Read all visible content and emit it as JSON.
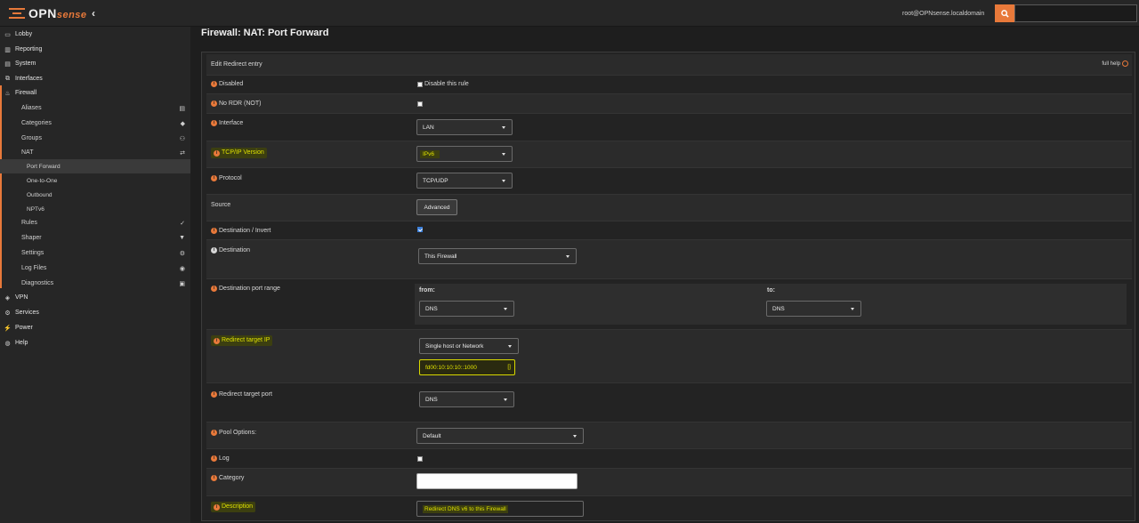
{
  "topbar": {
    "logo_main": "OPN",
    "logo_sense": "sense",
    "collapse_glyph": "‹",
    "user": "root@OPNsense.localdomain",
    "search_icon": "search-icon",
    "search_value": ""
  },
  "sidebar": {
    "items": [
      {
        "label": "Lobby",
        "icon": "▭"
      },
      {
        "label": "Reporting",
        "icon": "▥"
      },
      {
        "label": "System",
        "icon": "▤"
      },
      {
        "label": "Interfaces",
        "icon": "⧉"
      },
      {
        "label": "Firewall",
        "icon": "♨"
      },
      {
        "label": "Aliases",
        "right": "▤"
      },
      {
        "label": "Categories",
        "right": "◆"
      },
      {
        "label": "Groups",
        "right": "⚇"
      },
      {
        "label": "NAT",
        "right": "⇄"
      },
      {
        "label": "Port Forward"
      },
      {
        "label": "One-to-One"
      },
      {
        "label": "Outbound"
      },
      {
        "label": "NPTv6"
      },
      {
        "label": "Rules",
        "right": "✓"
      },
      {
        "label": "Shaper",
        "right": "▼"
      },
      {
        "label": "Settings",
        "right": "⚙"
      },
      {
        "label": "Log Files",
        "right": "◉"
      },
      {
        "label": "Diagnostics",
        "right": "▣"
      },
      {
        "label": "VPN",
        "icon": "◈"
      },
      {
        "label": "Services",
        "icon": "⚙"
      },
      {
        "label": "Power",
        "icon": "⚡"
      },
      {
        "label": "Help",
        "icon": "◍"
      }
    ]
  },
  "page": {
    "title": "Firewall: NAT: Port Forward",
    "panel_title": "Edit Redirect entry",
    "full_help": "full help"
  },
  "form": {
    "disabled": {
      "label": "Disabled",
      "checkbox_label": "Disable this rule",
      "checked": false
    },
    "no_rdr": {
      "label": "No RDR (NOT)",
      "checked": false
    },
    "interface": {
      "label": "Interface",
      "value": "LAN"
    },
    "tcpip_version": {
      "label": "TCP/IP Version",
      "value": "IPv6"
    },
    "protocol": {
      "label": "Protocol",
      "value": "TCP/UDP"
    },
    "source": {
      "label": "Source",
      "button": "Advanced"
    },
    "dest_invert": {
      "label": "Destination / Invert",
      "checked": true
    },
    "destination": {
      "label": "Destination",
      "value": "This Firewall"
    },
    "dest_port_range": {
      "label": "Destination port range",
      "from_label": "from:",
      "to_label": "to:",
      "from_value": "DNS",
      "to_value": "DNS"
    },
    "redirect_ip": {
      "label": "Redirect target IP",
      "type_value": "Single host or Network",
      "address": "fd00:10:10:10::1000",
      "address_suffix": "[]"
    },
    "redirect_port": {
      "label": "Redirect target port",
      "value": "DNS"
    },
    "pool_options": {
      "label": "Pool Options:",
      "value": "Default"
    },
    "log": {
      "label": "Log",
      "checked": false
    },
    "category": {
      "label": "Category",
      "value": ""
    },
    "description": {
      "label": "Description",
      "value": "Redirect DNS v6 to this Firewall"
    },
    "source_plain_label": "Source"
  },
  "colors": {
    "accent": "#e8793a",
    "highlight": "#e0e200",
    "check": "#3b7ed8"
  }
}
